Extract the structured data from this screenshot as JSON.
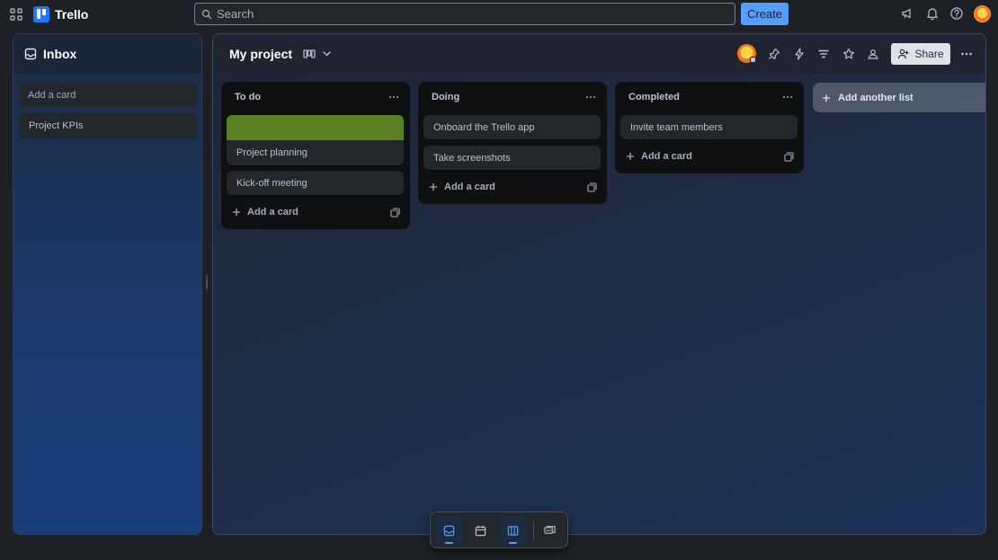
{
  "app": {
    "name": "Trello",
    "search_placeholder": "Search",
    "create_label": "Create"
  },
  "inbox": {
    "title": "Inbox",
    "add_card_placeholder": "Add a card",
    "cards": [
      {
        "title": "Project KPIs"
      }
    ]
  },
  "board": {
    "title": "My project",
    "share_label": "Share",
    "lists": [
      {
        "title": "To do",
        "cards": [
          {
            "title": "Project planning",
            "cover_color": "#5b7f24"
          },
          {
            "title": "Kick-off meeting"
          }
        ],
        "add_card_label": "Add a card"
      },
      {
        "title": "Doing",
        "cards": [
          {
            "title": "Onboard the Trello app"
          },
          {
            "title": "Take screenshots"
          }
        ],
        "add_card_label": "Add a card"
      },
      {
        "title": "Completed",
        "cards": [
          {
            "title": "Invite team members"
          }
        ],
        "add_card_label": "Add a card"
      }
    ],
    "add_list_label": "Add another list"
  },
  "colors": {
    "accent": "#579dff",
    "list_bg": "#0f1012",
    "card_bg": "#22272b",
    "cover_green": "#5b7f24"
  },
  "icons": {
    "topbar_right": [
      "megaphone-icon",
      "bell-icon",
      "help-icon"
    ],
    "board_header": [
      "pin-icon",
      "automation-icon",
      "filter-icon",
      "star-icon",
      "visibility-icon",
      "more-icon"
    ],
    "switcher": [
      "inbox-icon",
      "calendar-icon",
      "board-icon",
      "switch-boards-icon"
    ]
  }
}
